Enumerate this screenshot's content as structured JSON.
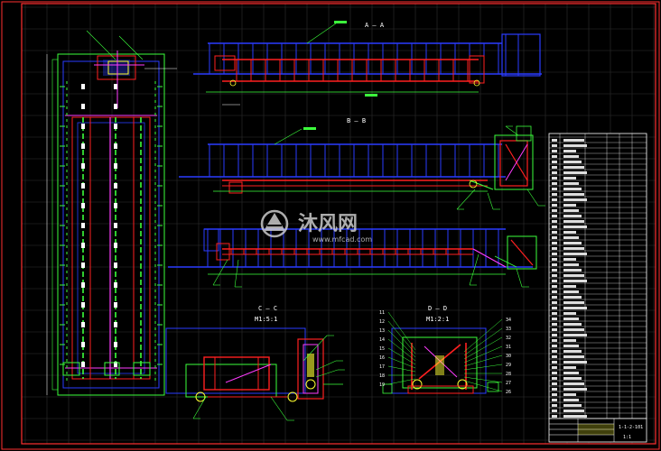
{
  "colors": {
    "background": "#000000",
    "border": "#ff3030",
    "grid": "#3a3a3a",
    "structure_blue": "#2a3cff",
    "structure_red": "#ff2020",
    "magenta": "#ff3cff",
    "green": "#3cff3c",
    "yellow": "#ffff30",
    "cyan": "#30ffff",
    "white": "#ffffff"
  },
  "views": {
    "view1_label": "A — A",
    "view2_label": "B — B",
    "section_c_label": "C — C",
    "section_c_scale": "M1:5:1",
    "section_d_label": "D — D",
    "section_d_scale": "M1:2:1"
  },
  "callouts_section_d_left": [
    "11",
    "12",
    "13",
    "14",
    "15",
    "16",
    "17",
    "18",
    "19"
  ],
  "callouts_section_d_right": [
    "34",
    "33",
    "32",
    "31",
    "30",
    "29",
    "28",
    "27",
    "26"
  ],
  "title_block": {
    "drawing_no": "1-1-2-101",
    "sheet_label": "1:1"
  },
  "watermark": {
    "brand": "沐风网",
    "url": "www.mfcad.com"
  }
}
